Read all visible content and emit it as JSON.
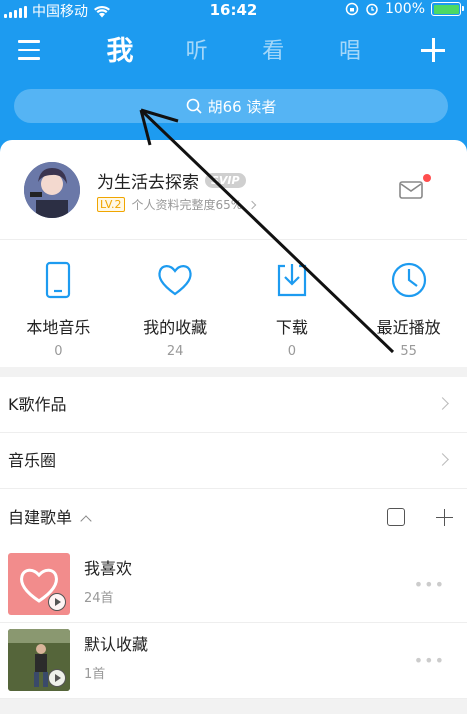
{
  "status_bar": {
    "carrier": "中国移动",
    "time": "16:42",
    "battery": "100%",
    "battery_level": 1.0
  },
  "nav": {
    "tabs": [
      "我",
      "听",
      "看",
      "唱"
    ],
    "active_tab": 0
  },
  "search": {
    "placeholder": "胡66 读者"
  },
  "profile": {
    "username": "为生活去探索",
    "vip_badge": "SVIP",
    "level": "LV.2",
    "completion": "个人资料完整度65%",
    "has_new_message": true
  },
  "quick": [
    {
      "label": "本地音乐",
      "count": "0",
      "icon": "phone-icon"
    },
    {
      "label": "我的收藏",
      "count": "24",
      "icon": "heart-icon"
    },
    {
      "label": "下载",
      "count": "0",
      "icon": "download-icon"
    },
    {
      "label": "最近播放",
      "count": "55",
      "icon": "clock-icon"
    }
  ],
  "rows": [
    {
      "label": "K歌作品"
    },
    {
      "label": "音乐圈"
    }
  ],
  "section": {
    "title": "自建歌单"
  },
  "playlists": [
    {
      "title": "我喜欢",
      "count": "24首"
    },
    {
      "title": "默认收藏",
      "count": "1首"
    }
  ],
  "colors": {
    "accent": "#1d9bf0",
    "cover_like": "#f28c8c",
    "badge_dot": "#ff4e4e"
  }
}
